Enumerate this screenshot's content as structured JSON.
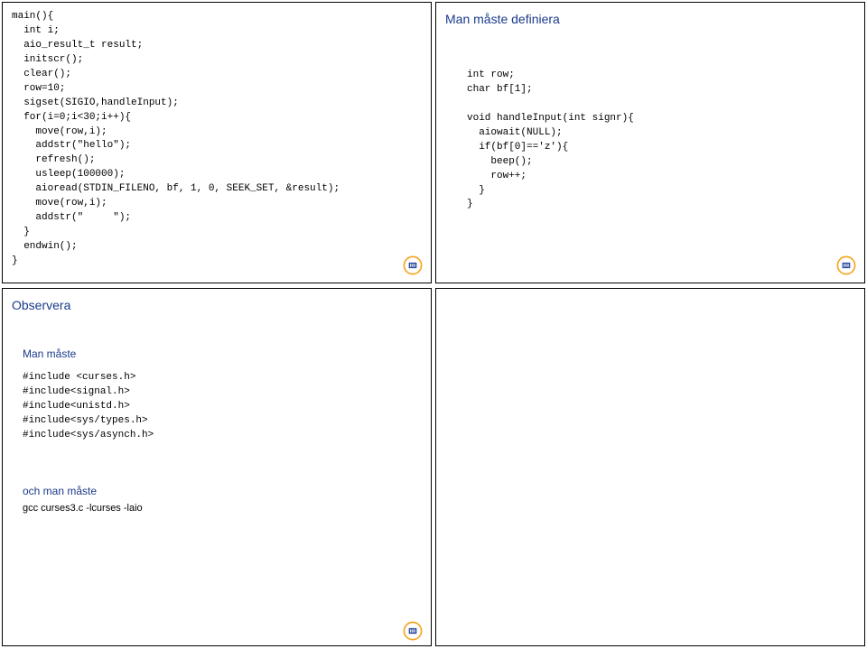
{
  "slides": {
    "topLeft": {
      "code": "main(){\n  int i;\n  aio_result_t result;\n  initscr();\n  clear();\n  row=10;\n  sigset(SIGIO,handleInput);\n  for(i=0;i<30;i++){\n    move(row,i);\n    addstr(\"hello\");\n    refresh();\n    usleep(100000);\n    aioread(STDIN_FILENO, bf, 1, 0, SEEK_SET, &result);\n    move(row,i);\n    addstr(\"     \");\n  }\n  endwin();\n}"
    },
    "topRight": {
      "heading": "Man måste definiera",
      "code": "int row;\nchar bf[1];\n\nvoid handleInput(int signr){\n  aiowait(NULL);\n  if(bf[0]=='z'){\n    beep();\n    row++;\n  }\n}"
    },
    "bottomLeft": {
      "heading": "Observera",
      "subheading1": "Man måste",
      "code1": "#include <curses.h>\n#include<signal.h>\n#include<unistd.h>\n#include<sys/types.h>\n#include<sys/asynch.h>",
      "subheading2": "och man måste",
      "line2": "gcc curses3.c -lcurses -laio"
    }
  }
}
